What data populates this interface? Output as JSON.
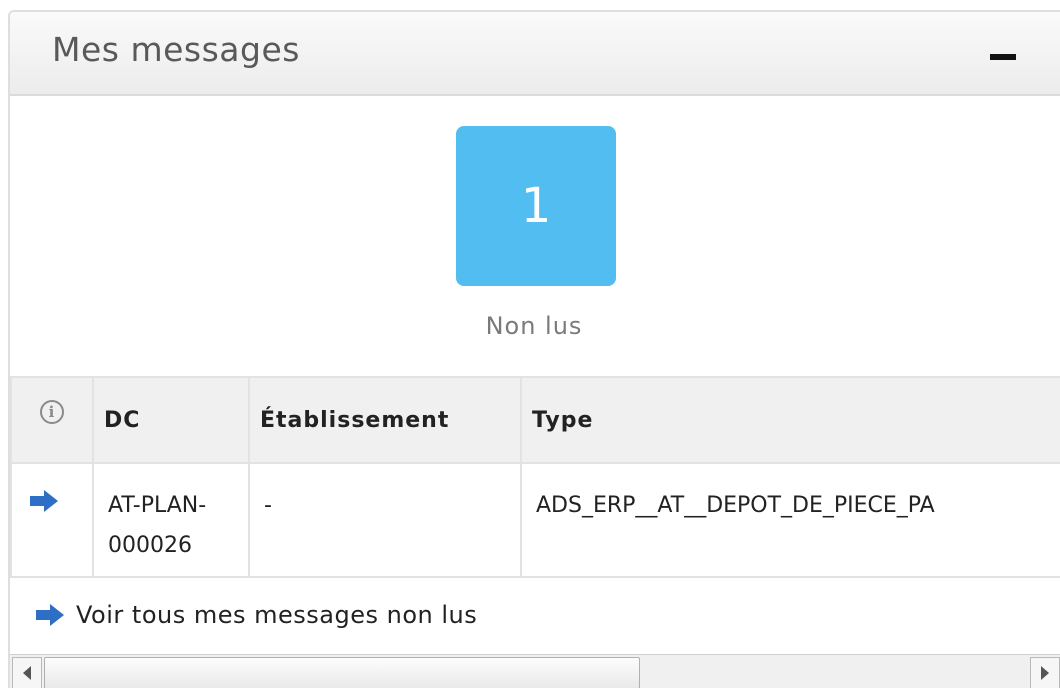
{
  "widget": {
    "title": "Mes messages",
    "collapse_icon": "minus-icon"
  },
  "counter": {
    "value": "1",
    "label": "Non lus",
    "color": "#52bdf0"
  },
  "table": {
    "info_icon": "info-circle-icon",
    "columns": [
      "DC",
      "Établissement",
      "Type"
    ],
    "rows": [
      {
        "icon": "arrow-right-icon",
        "dc": "AT-PLAN-000026",
        "dc_line1": "AT-PLAN-",
        "dc_line2": "000026",
        "etablissement": "-",
        "type": "ADS_ERP__AT__DEPOT_DE_PIECE_PA"
      }
    ]
  },
  "footer": {
    "link_label": "Voir tous mes messages non lus",
    "link_icon": "arrow-right-icon"
  },
  "colors": {
    "accent_arrow": "#2d6fc4",
    "header_bg": "#f0f0f0"
  }
}
